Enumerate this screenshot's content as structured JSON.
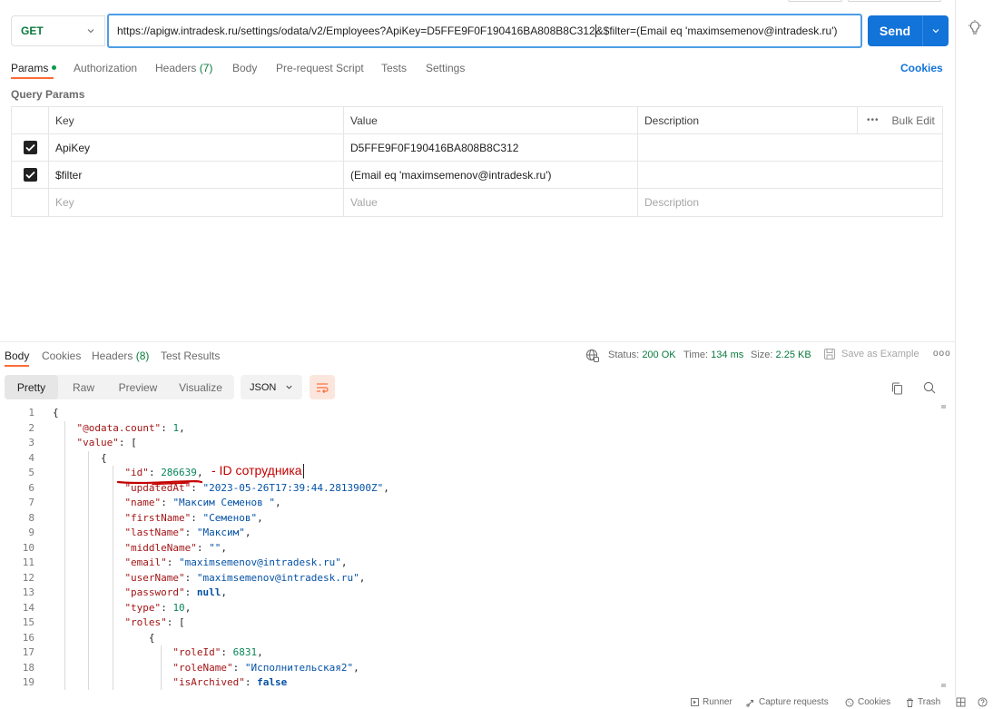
{
  "request": {
    "method": "GET",
    "url": "https://apigw.intradesk.ru/settings/odata/v2/Employees?ApiKey=D5FFE9F0F190416BA808B8C312",
    "url_after_caret": "&$filter=(Email eq 'maximsemenov@intradesk.ru')",
    "send_label": "Send"
  },
  "request_tabs": {
    "params": "Params",
    "authorization": "Authorization",
    "headers": "Headers",
    "headers_count": "(7)",
    "body": "Body",
    "pre_request": "Pre-request Script",
    "tests": "Tests",
    "settings": "Settings",
    "cookies": "Cookies"
  },
  "query_params": {
    "title": "Query Params",
    "columns": [
      "Key",
      "Value",
      "Description"
    ],
    "bulk_dots": "•••",
    "bulk_edit": "Bulk Edit",
    "rows": [
      {
        "key": "ApiKey",
        "value": "D5FFE9F0F190416BA808B8C312",
        "description": "",
        "checked": true
      },
      {
        "key": "$filter",
        "value": "(Email eq 'maximsemenov@intradesk.ru')",
        "description": "",
        "checked": true
      }
    ],
    "empty_row": {
      "key": "Key",
      "value": "Value",
      "description": "Description"
    }
  },
  "response_tabs": {
    "body": "Body",
    "cookies": "Cookies",
    "headers": "Headers",
    "headers_count": "(8)",
    "test_results": "Test Results"
  },
  "response_meta": {
    "status_label": "Status:",
    "status_value": "200 OK",
    "time_label": "Time:",
    "time_value": "134 ms",
    "size_label": "Size:",
    "size_value": "2.25 KB",
    "save_example": "Save as Example",
    "more": "ooo"
  },
  "view_modes": [
    "Pretty",
    "Raw",
    "Preview",
    "Visualize"
  ],
  "format_select": "JSON",
  "code_lines": [
    {
      "n": "1",
      "indent": 0,
      "tokens": [
        [
          "p",
          "{"
        ]
      ]
    },
    {
      "n": "2",
      "indent": 1,
      "tokens": [
        [
          "k",
          "\"@odata.count\""
        ],
        [
          "p",
          ": "
        ],
        [
          "n",
          "1"
        ],
        [
          "p",
          ","
        ]
      ]
    },
    {
      "n": "3",
      "indent": 1,
      "tokens": [
        [
          "k",
          "\"value\""
        ],
        [
          "p",
          ": ["
        ]
      ]
    },
    {
      "n": "4",
      "indent": 2,
      "tokens": [
        [
          "p",
          "{"
        ]
      ]
    },
    {
      "n": "5",
      "indent": 3,
      "tokens": [
        [
          "k",
          "\"id\""
        ],
        [
          "p",
          ": "
        ],
        [
          "n",
          "286639"
        ],
        [
          "p",
          ","
        ]
      ]
    },
    {
      "n": "6",
      "indent": 3,
      "tokens": [
        [
          "k",
          "\"updatedAt\""
        ],
        [
          "p",
          ": "
        ],
        [
          "s",
          "\"2023-05-26T17:39:44.2813900Z\""
        ],
        [
          "p",
          ","
        ]
      ]
    },
    {
      "n": "7",
      "indent": 3,
      "tokens": [
        [
          "k",
          "\"name\""
        ],
        [
          "p",
          ": "
        ],
        [
          "s",
          "\"Максим Семенов \""
        ],
        [
          "p",
          ","
        ]
      ]
    },
    {
      "n": "8",
      "indent": 3,
      "tokens": [
        [
          "k",
          "\"firstName\""
        ],
        [
          "p",
          ": "
        ],
        [
          "s",
          "\"Семенов\""
        ],
        [
          "p",
          ","
        ]
      ]
    },
    {
      "n": "9",
      "indent": 3,
      "tokens": [
        [
          "k",
          "\"lastName\""
        ],
        [
          "p",
          ": "
        ],
        [
          "s",
          "\"Максим\""
        ],
        [
          "p",
          ","
        ]
      ]
    },
    {
      "n": "10",
      "indent": 3,
      "tokens": [
        [
          "k",
          "\"middleName\""
        ],
        [
          "p",
          ": "
        ],
        [
          "s",
          "\"\""
        ],
        [
          "p",
          ","
        ]
      ]
    },
    {
      "n": "11",
      "indent": 3,
      "tokens": [
        [
          "k",
          "\"email\""
        ],
        [
          "p",
          ": "
        ],
        [
          "s",
          "\"maximsemenov@intradesk.ru\""
        ],
        [
          "p",
          ","
        ]
      ]
    },
    {
      "n": "12",
      "indent": 3,
      "tokens": [
        [
          "k",
          "\"userName\""
        ],
        [
          "p",
          ": "
        ],
        [
          "s",
          "\"maximsemenov@intradesk.ru\""
        ],
        [
          "p",
          ","
        ]
      ]
    },
    {
      "n": "13",
      "indent": 3,
      "tokens": [
        [
          "k",
          "\"password\""
        ],
        [
          "p",
          ": "
        ],
        [
          "b",
          "null"
        ],
        [
          "p",
          ","
        ]
      ]
    },
    {
      "n": "14",
      "indent": 3,
      "tokens": [
        [
          "k",
          "\"type\""
        ],
        [
          "p",
          ": "
        ],
        [
          "n",
          "10"
        ],
        [
          "p",
          ","
        ]
      ]
    },
    {
      "n": "15",
      "indent": 3,
      "tokens": [
        [
          "k",
          "\"roles\""
        ],
        [
          "p",
          ": ["
        ]
      ]
    },
    {
      "n": "16",
      "indent": 4,
      "tokens": [
        [
          "p",
          "{"
        ]
      ]
    },
    {
      "n": "17",
      "indent": 5,
      "tokens": [
        [
          "k",
          "\"roleId\""
        ],
        [
          "p",
          ": "
        ],
        [
          "n",
          "6831"
        ],
        [
          "p",
          ","
        ]
      ]
    },
    {
      "n": "18",
      "indent": 5,
      "tokens": [
        [
          "k",
          "\"roleName\""
        ],
        [
          "p",
          ": "
        ],
        [
          "s",
          "\"Исполнительская2\""
        ],
        [
          "p",
          ","
        ]
      ]
    },
    {
      "n": "19",
      "indent": 5,
      "tokens": [
        [
          "k",
          "\"isArchived\""
        ],
        [
          "p",
          ": "
        ],
        [
          "b",
          "false"
        ]
      ]
    }
  ],
  "annotation": "- ID сотрудника",
  "footer": {
    "runner": "Runner",
    "capture": "Capture requests",
    "cookies": "Cookies",
    "trash": "Trash"
  },
  "colors": {
    "accent_orange": "#ff6c37",
    "send_blue": "#1273d8",
    "status_green": "#0a7a3c",
    "annotation_red": "#c40000"
  },
  "icons": [
    "bulb-icon",
    "chevron-down-icon",
    "globe-icon",
    "save-icon",
    "copy-icon",
    "search-icon",
    "wrap-icon",
    "runner-icon",
    "capture-icon",
    "cookie-icon",
    "trash-icon",
    "layout-icon",
    "help-icon"
  ]
}
